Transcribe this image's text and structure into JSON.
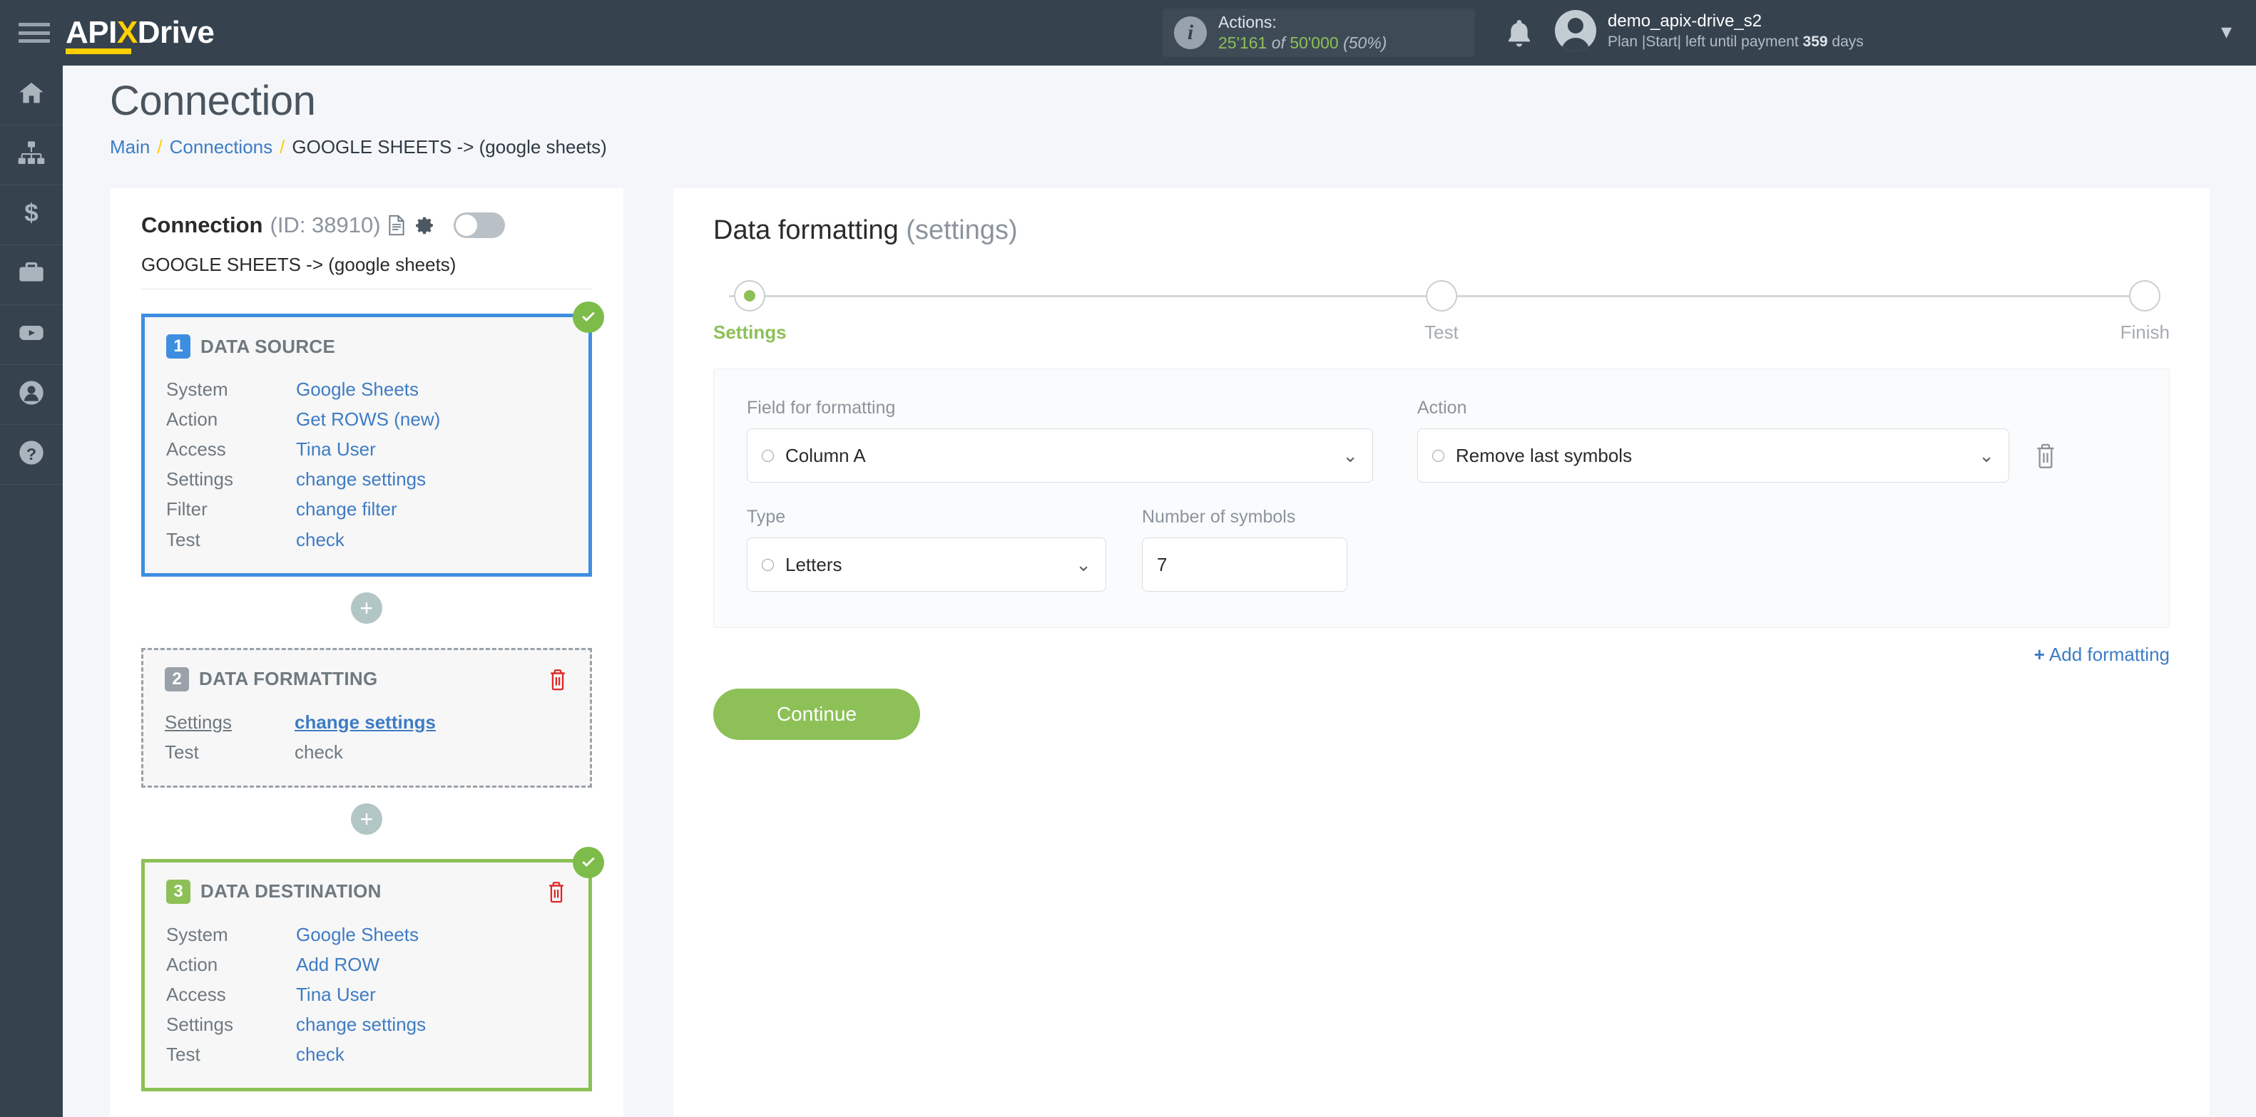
{
  "topbar": {
    "logo_api": "API",
    "logo_x": "X",
    "logo_drive": "Drive",
    "actions_label": "Actions:",
    "actions_used": "25'161",
    "actions_of": "of",
    "actions_total": "50'000",
    "actions_percent": "(50%)",
    "account_name": "demo_apix-drive_s2",
    "plan_prefix": "Plan |Start| left until payment ",
    "plan_days": "359",
    "plan_suffix": " days"
  },
  "rail": {
    "items": [
      {
        "icon": "home-icon"
      },
      {
        "icon": "sitemap-icon"
      },
      {
        "icon": "dollar-icon"
      },
      {
        "icon": "briefcase-icon"
      },
      {
        "icon": "youtube-icon"
      },
      {
        "icon": "user-icon"
      },
      {
        "icon": "help-icon"
      }
    ]
  },
  "page": {
    "title": "Connection",
    "breadcrumb": {
      "main": "Main",
      "connections": "Connections",
      "current": "GOOGLE SHEETS -> (google sheets)",
      "separator": "/"
    }
  },
  "connection": {
    "title": "Connection",
    "id_label": "(ID: 38910)",
    "subtitle": "GOOGLE SHEETS -> (google sheets)",
    "cards": [
      {
        "number": "1",
        "title": "DATA SOURCE",
        "rows": [
          {
            "key": "System",
            "value": "Google Sheets"
          },
          {
            "key": "Action",
            "value": "Get ROWS (new)"
          },
          {
            "key": "Access",
            "value": "Tina User"
          },
          {
            "key": "Settings",
            "value": "change settings"
          },
          {
            "key": "Filter",
            "value": "change filter"
          },
          {
            "key": "Test",
            "value": "check"
          }
        ]
      },
      {
        "number": "2",
        "title": "DATA FORMATTING",
        "rows": [
          {
            "key": "Settings",
            "value": "change settings"
          },
          {
            "key": "Test",
            "value": "check"
          }
        ]
      },
      {
        "number": "3",
        "title": "DATA DESTINATION",
        "rows": [
          {
            "key": "System",
            "value": "Google Sheets"
          },
          {
            "key": "Action",
            "value": "Add ROW"
          },
          {
            "key": "Access",
            "value": "Tina User"
          },
          {
            "key": "Settings",
            "value": "change settings"
          },
          {
            "key": "Test",
            "value": "check"
          }
        ]
      }
    ],
    "add_step_label": "+"
  },
  "panel": {
    "title_main": "Data formatting",
    "title_muted": "(settings)",
    "steps": [
      {
        "label": "Settings"
      },
      {
        "label": "Test"
      },
      {
        "label": "Finish"
      }
    ],
    "form": {
      "field_label": "Field for formatting",
      "field_value": "Column A",
      "action_label": "Action",
      "action_value": "Remove last symbols",
      "type_label": "Type",
      "type_value": "Letters",
      "symbols_label": "Number of symbols",
      "symbols_value": "7"
    },
    "add_formatting": "Add formatting",
    "add_formatting_plus": "+",
    "continue_label": "Continue"
  },
  "colors": {
    "topbar_bg": "#36434f",
    "accent_yellow": "#ffcf00",
    "accent_green": "#8dc057",
    "accent_blue": "#3e8ee0",
    "link_blue": "#3e7cc4",
    "danger_red": "#e02424"
  }
}
